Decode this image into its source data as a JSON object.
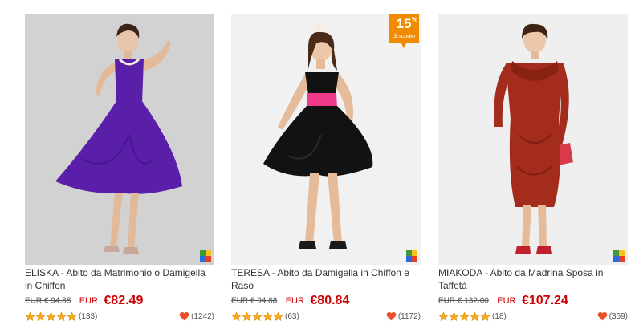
{
  "products": [
    {
      "title": "ELISKA - Abito da Matrimonio o Damigella in Chiffon",
      "old_price": "EUR € 94.88",
      "currency": "EUR",
      "price": "€82.49",
      "reviews": "(133)",
      "likes": "(1242)",
      "image": "model-purple-chiffon-dress",
      "dress_color": "#5a1fa8",
      "bg_color": "#d4d4d4",
      "rating": 5
    },
    {
      "title": "TERESA - Abito da Damigella in Chiffon e Raso",
      "old_price": "EUR € 94.88",
      "currency": "EUR",
      "price": "€80.84",
      "reviews": "(63)",
      "likes": "(1172)",
      "image": "model-black-pink-dress",
      "dress_color": "#111111",
      "sash_color": "#ef3a8a",
      "bg_color": "#f1f1f1",
      "rating": 5,
      "promo": {
        "number": "15",
        "percent": "%",
        "text": "di sconto",
        "color": "#f08a00"
      }
    },
    {
      "title": "MIAKODA - Abito da Madrina Sposa in Taffetà",
      "old_price": "EUR € 132.00",
      "currency": "EUR",
      "price": "€107.24",
      "reviews": "(18)",
      "likes": "(359)",
      "image": "model-red-taffeta-dress",
      "dress_color": "#a32c1c",
      "bg_color": "#efefef",
      "rating": 5
    }
  ],
  "colors": {
    "price": "#cc0000",
    "star": "#f6a81e",
    "heart": "#e8502e"
  },
  "icons": [
    "star-icon",
    "heart-icon",
    "color-swatch-icon"
  ]
}
